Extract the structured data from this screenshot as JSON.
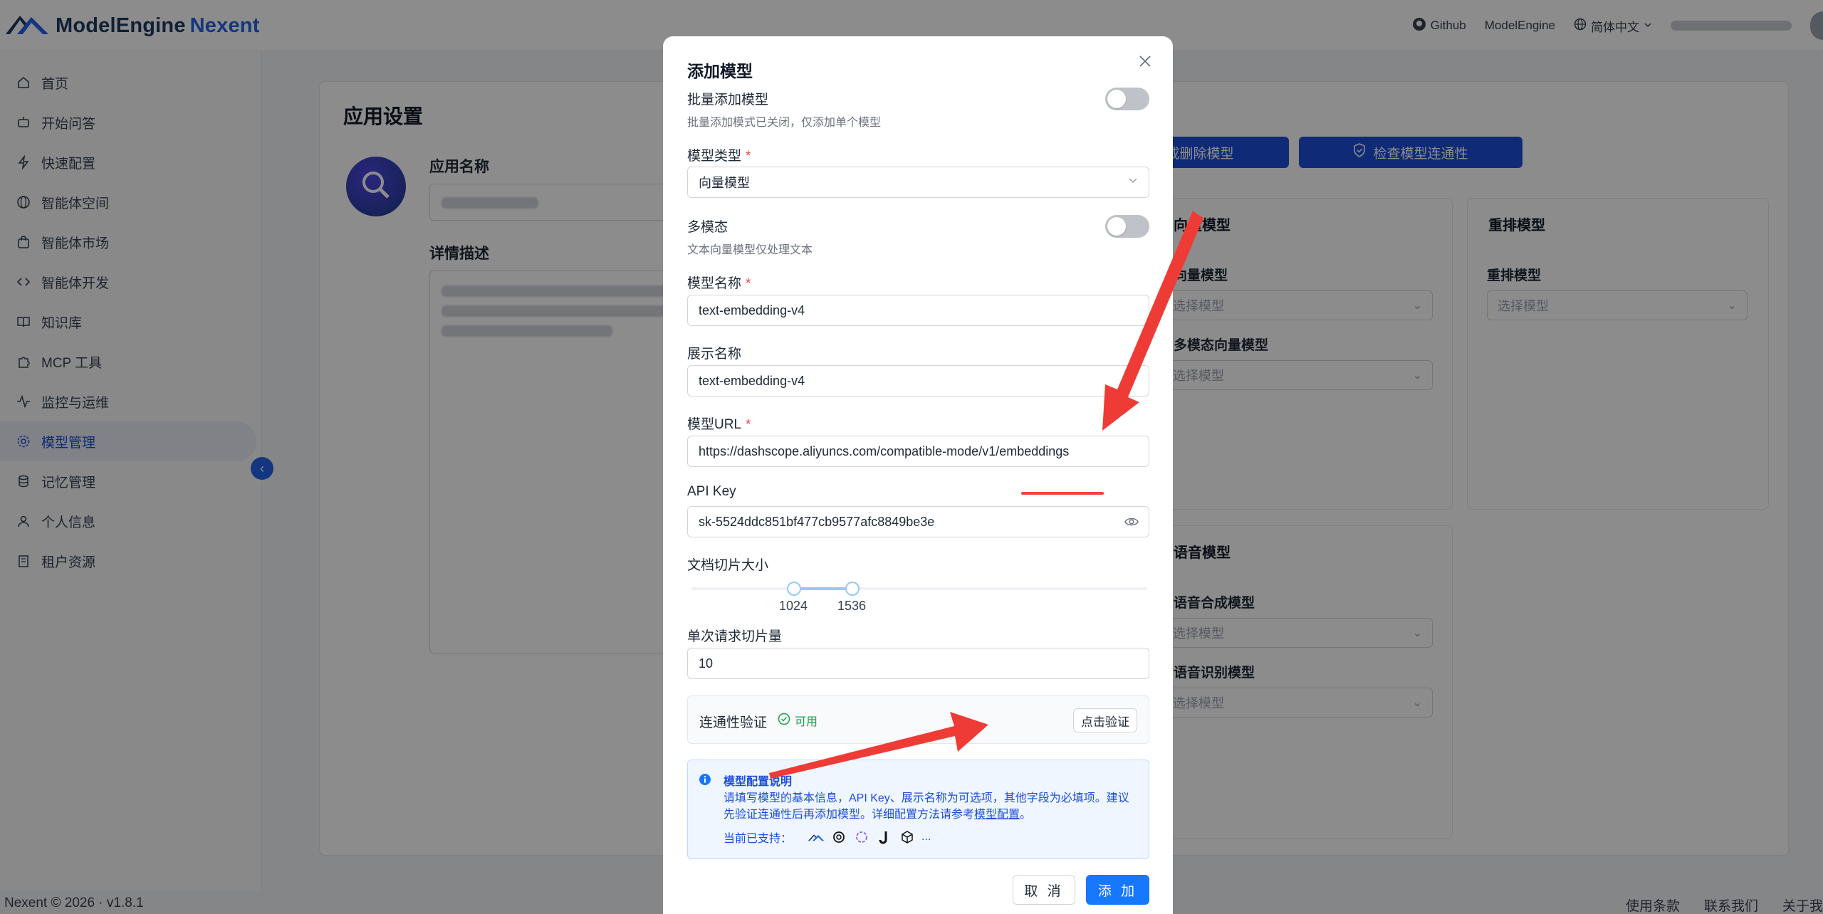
{
  "brand": {
    "name": "ModelEngine",
    "product": "Nexent"
  },
  "topbar": {
    "github_label": "Github",
    "modelengine_label": "ModelEngine",
    "language_label": "简体中文"
  },
  "sidebar": {
    "items": [
      {
        "label": "首页",
        "icon": "home-icon"
      },
      {
        "label": "开始问答",
        "icon": "chat-bot-icon"
      },
      {
        "label": "快速配置",
        "icon": "lightning-icon"
      },
      {
        "label": "智能体空间",
        "icon": "globe-icon"
      },
      {
        "label": "智能体市场",
        "icon": "shopping-bag-icon"
      },
      {
        "label": "智能体开发",
        "icon": "code-icon"
      },
      {
        "label": "知识库",
        "icon": "book-icon"
      },
      {
        "label": "MCP 工具",
        "icon": "puzzle-icon"
      },
      {
        "label": "监控与运维",
        "icon": "activity-icon"
      },
      {
        "label": "模型管理",
        "icon": "gear-icon",
        "active": true
      },
      {
        "label": "记忆管理",
        "icon": "database-icon"
      },
      {
        "label": "个人信息",
        "icon": "user-icon"
      },
      {
        "label": "租户资源",
        "icon": "building-icon"
      }
    ]
  },
  "app_settings": {
    "title": "应用设置",
    "name_label": "应用名称",
    "desc_label": "详情描述"
  },
  "model_panels": {
    "delete_button": "或删除模型",
    "check_button": "检查模型连通性",
    "embedding_title": "向量模型",
    "embedding_label": "向量模型",
    "multimodal_embedding_label": "多模态向量模型",
    "rerank_title": "重排模型",
    "rerank_label": "重排模型",
    "voice_title": "语音模型",
    "tts_label": "语音合成模型",
    "asr_label": "语音识别模型",
    "select_placeholder": "选择模型"
  },
  "footer": {
    "copyright": "Nexent © 2026 · v1.8.1",
    "links": [
      "使用条款",
      "联系我们",
      "关于我"
    ]
  },
  "modal": {
    "title": "添加模型",
    "batch_label": "批量添加模型",
    "batch_hint": "批量添加模式已关闭，仅添加单个模型",
    "batch_enabled": false,
    "type_label": "模型类型",
    "type_value": "向量模型",
    "multimodal_label": "多模态",
    "multimodal_hint": "文本向量模型仅处理文本",
    "multimodal_enabled": false,
    "name_label": "模型名称",
    "name_value": "text-embedding-v4",
    "display_label": "展示名称",
    "display_value": "text-embedding-v4",
    "url_label": "模型URL",
    "url_value": "https://dashscope.aliyuncs.com/compatible-mode/v1/embeddings",
    "apikey_label": "API Key",
    "apikey_value": "sk-5524ddc851bf477cb9577afc8849be3e",
    "chunk_label": "文档切片大小",
    "chunk_min": "1024",
    "chunk_max": "1536",
    "batch_size_label": "单次请求切片量",
    "batch_size_value": "10",
    "conn_label": "连通性验证",
    "conn_status": "可用",
    "verify_button": "点击验证",
    "info_title": "模型配置说明",
    "info_body": "请填写模型的基本信息，API Key、展示名称为可选项，其他字段为必填项。建议先验证连通性后再添加模型。详细配置方法请参考",
    "info_link": "模型配置",
    "info_end": "。",
    "support_label": "当前已支持：",
    "support_more": "...",
    "cancel_button": "取 消",
    "add_button": "添 加"
  },
  "colors": {
    "primary": "#1677ff",
    "nav_active": "#1d4ed8",
    "required": "#ef4444",
    "success": "#16a34a",
    "annotation_arrow": "#ef3b36"
  }
}
